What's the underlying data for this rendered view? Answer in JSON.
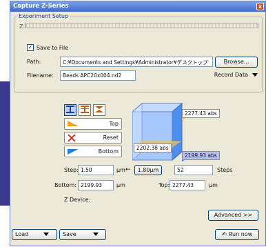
{
  "window": {
    "title": "Capture Z-Series",
    "close_glyph": "x"
  },
  "experiment": {
    "legend": "Experiment Setup",
    "progress_label": "Z:",
    "save_to_file_label": "Save to File",
    "save_to_file_checked": true,
    "path_label": "Path:",
    "path_value": "C:¥Documents and Settings¥Administrator¥デスクトップ",
    "browse_label": "Browse...",
    "filename_label": "Filename:",
    "filename_value": "Beads APC20x004.nd2",
    "record_label": "Record Data"
  },
  "z_controls": {
    "mode_icons": [
      "top-bottom-mode-icon",
      "range-mode-icon",
      "symmetric-mode-icon"
    ],
    "top_label": "Top",
    "reset_label": "Reset",
    "bottom_label": "Bottom",
    "tag_top": "2277.43 abs",
    "tag_current": "2202.38 abs",
    "tag_bottom": "2199.93 abs"
  },
  "step": {
    "step_label": "Step:",
    "step_value": "1.50",
    "step_unit": "µm",
    "arrow_glyph": "←",
    "suggested_value": "1.80µm",
    "steps_value": "52",
    "steps_label": "Steps",
    "bottom_label": "Bottom:",
    "bottom_value": "2199.93",
    "bottom_unit": "µm",
    "top_label": "Top:",
    "top_value": "2277.43",
    "top_unit": "µm",
    "zdevice_label": "Z Device:"
  },
  "footer": {
    "advanced_label": "Advanced >>",
    "load_label": "Load",
    "save_label": "Save",
    "run_label": "Run now"
  }
}
